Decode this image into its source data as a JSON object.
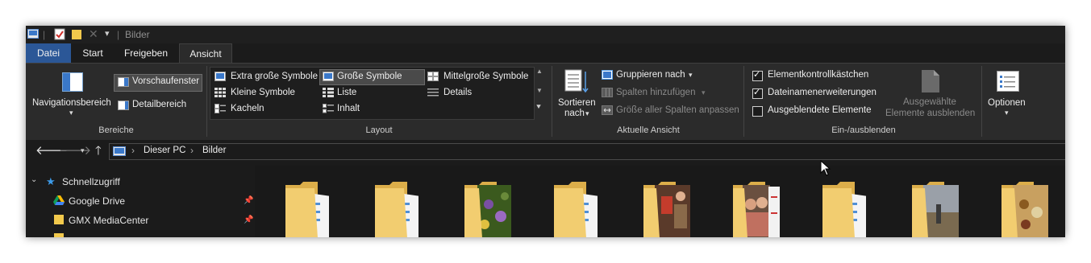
{
  "titlebar": {
    "title": "Bilder",
    "separator": "|"
  },
  "tabs": [
    {
      "label": "Datei"
    },
    {
      "label": "Start"
    },
    {
      "label": "Freigeben"
    },
    {
      "label": "Ansicht"
    }
  ],
  "ribbon": {
    "bereiche": {
      "nav_pane": "Navigationsbereich",
      "preview": "Vorschaufenster",
      "details": "Detailbereich",
      "label": "Bereiche"
    },
    "layout": {
      "items": [
        "Extra große Symbole",
        "Große Symbole",
        "Mittelgroße Symbole",
        "Kleine Symbole",
        "Liste",
        "Details",
        "Kacheln",
        "Inhalt"
      ],
      "label": "Layout"
    },
    "current_view": {
      "sort": "Sortieren",
      "sort_by": "nach",
      "group": "Gruppieren nach",
      "add_columns": "Spalten hinzufügen",
      "fit_columns": "Größe aller Spalten anpassen",
      "label": "Aktuelle Ansicht"
    },
    "show_hide": {
      "checkboxes": [
        {
          "label": "Elementkontrollkästchen",
          "checked": true
        },
        {
          "label": "Dateinamenerweiterungen",
          "checked": true
        },
        {
          "label": "Ausgeblendete Elemente",
          "checked": false
        }
      ],
      "hide_selected_1": "Ausgewählte",
      "hide_selected_2": "Elemente ausblenden",
      "label": "Ein-/ausblenden"
    },
    "options": "Optionen"
  },
  "address": {
    "crumbs": [
      "Dieser PC",
      "Bilder"
    ],
    "separator": "›"
  },
  "nav_tree": [
    {
      "label": "Schnellzugriff"
    },
    {
      "label": "Google Drive"
    },
    {
      "label": "GMX MediaCenter"
    }
  ],
  "colors": {
    "file_tab": "#2b5797",
    "folder": "#e8c56b",
    "background": "#1b1b1b"
  }
}
